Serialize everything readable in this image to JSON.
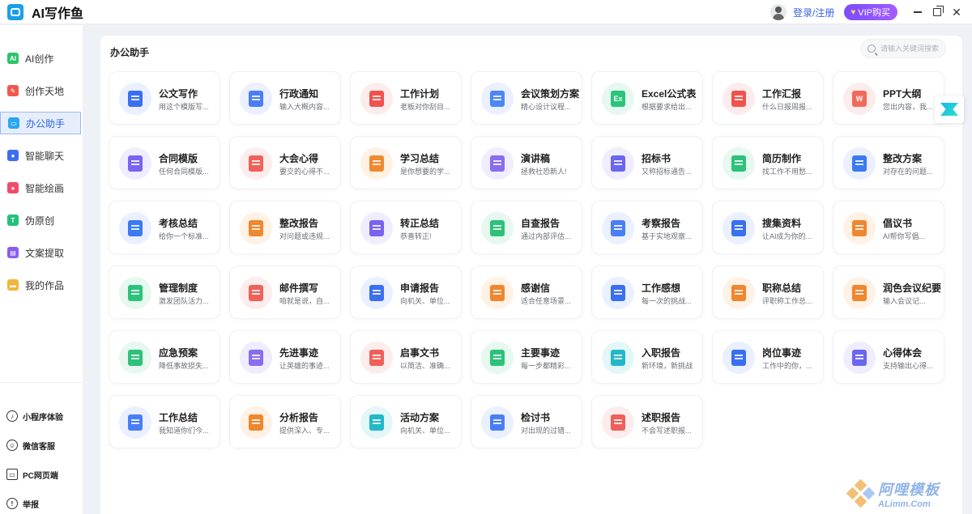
{
  "app": {
    "title": "AI写作鱼"
  },
  "header": {
    "login": "登录/注册",
    "vip": "VIP购买",
    "vip_icon": "heart-icon"
  },
  "sidebar": {
    "items": [
      {
        "label": "AI创作",
        "icon": "ai-create-icon",
        "color": "#2bc46b",
        "glyph": "AI",
        "active": false
      },
      {
        "label": "创作天地",
        "icon": "pen-icon",
        "color": "#f1564f",
        "glyph": "✎",
        "active": false
      },
      {
        "label": "办公助手",
        "icon": "briefcase-icon",
        "color": "#2aa7f0",
        "glyph": "▭",
        "active": true
      },
      {
        "label": "智能聊天",
        "icon": "chat-icon",
        "color": "#3d6ef0",
        "glyph": "●",
        "active": false
      },
      {
        "label": "智能绘画",
        "icon": "palette-icon",
        "color": "#f14a6b",
        "glyph": "●",
        "active": false
      },
      {
        "label": "伪原创",
        "icon": "rewrite-icon",
        "color": "#22c27a",
        "glyph": "T",
        "active": false
      },
      {
        "label": "文案提取",
        "icon": "extract-icon",
        "color": "#8a5cf0",
        "glyph": "▤",
        "active": false
      },
      {
        "label": "我的作品",
        "icon": "folder-icon",
        "color": "#f4b43a",
        "glyph": "▬",
        "active": false
      }
    ],
    "bottom": [
      {
        "label": "小程序体验",
        "icon": "miniprogram-icon"
      },
      {
        "label": "微信客服",
        "icon": "wechat-service-icon"
      },
      {
        "label": "PC网页端",
        "icon": "pc-web-icon"
      },
      {
        "label": "举报",
        "icon": "report-icon"
      }
    ]
  },
  "main": {
    "title": "办公助手",
    "search_placeholder": "请输入关键词搜索",
    "cards": [
      {
        "title": "公文写作",
        "desc": "用这个模版写...",
        "color": "#3b6ff2",
        "bg": "#eaf0ff"
      },
      {
        "title": "行政通知",
        "desc": "输入大概内容...",
        "color": "#4a7ef5",
        "bg": "#eaf0ff"
      },
      {
        "title": "工作计划",
        "desc": "老板对你刮目...",
        "color": "#f0524d",
        "bg": "#fdecec"
      },
      {
        "title": "会议策划方案",
        "desc": "精心设计议程...",
        "color": "#4d86f5",
        "bg": "#eaf0ff"
      },
      {
        "title": "Excel公式表",
        "desc": "根据要求给出...",
        "color": "#2bc47a",
        "bg": "#e6f8ef",
        "glyph": "Ex"
      },
      {
        "title": "工作汇报",
        "desc": "什么日报周报...",
        "color": "#f0524d",
        "bg": "#fdecec"
      },
      {
        "title": "PPT大纲",
        "desc": "您出内容，我...",
        "color": "#f06a5a",
        "bg": "#fdecec",
        "glyph": "W"
      },
      {
        "title": "合同模版",
        "desc": "任何合同模版...",
        "color": "#7a63f2",
        "bg": "#efedff"
      },
      {
        "title": "大会心得",
        "desc": "要交的心得不...",
        "color": "#f0605a",
        "bg": "#fdecec"
      },
      {
        "title": "学习总结",
        "desc": "是你想要的学...",
        "color": "#f08a2e",
        "bg": "#fff1e4"
      },
      {
        "title": "演讲稿",
        "desc": "拯救社恐新人!",
        "color": "#8a6cf0",
        "bg": "#efedff"
      },
      {
        "title": "招标书",
        "desc": "又称招标通告...",
        "color": "#6a66f0",
        "bg": "#efedff"
      },
      {
        "title": "简历制作",
        "desc": "找工作不用愁...",
        "color": "#2cc27a",
        "bg": "#e6f8ef"
      },
      {
        "title": "整改方案",
        "desc": "对存在的问题...",
        "color": "#3b7af2",
        "bg": "#eaf0ff"
      },
      {
        "title": "考核总结",
        "desc": "给你一个标准...",
        "color": "#3b7af2",
        "bg": "#eaf0ff"
      },
      {
        "title": "整改报告",
        "desc": "对问题或违规...",
        "color": "#f0862e",
        "bg": "#fff1e4"
      },
      {
        "title": "转正总结",
        "desc": "恭喜转正!",
        "color": "#7a63f2",
        "bg": "#efedff"
      },
      {
        "title": "自查报告",
        "desc": "通过内部评估...",
        "color": "#2cc27a",
        "bg": "#e6f8ef"
      },
      {
        "title": "考察报告",
        "desc": "基于实地观察...",
        "color": "#4a7ef5",
        "bg": "#eaf0ff"
      },
      {
        "title": "搜集资料",
        "desc": "让AI成为你的...",
        "color": "#3b6ff2",
        "bg": "#eaf0ff"
      },
      {
        "title": "倡议书",
        "desc": "AI帮你写倡...",
        "color": "#f0862e",
        "bg": "#fff1e4"
      },
      {
        "title": "管理制度",
        "desc": "激发团队活力...",
        "color": "#2cc27a",
        "bg": "#e6f8ef"
      },
      {
        "title": "邮件撰写",
        "desc": "咱就是说，自...",
        "color": "#f0605a",
        "bg": "#fdecec"
      },
      {
        "title": "申请报告",
        "desc": "向机关、单位...",
        "color": "#3b6ff2",
        "bg": "#eaf0ff"
      },
      {
        "title": "感谢信",
        "desc": "适合任意场景...",
        "color": "#f0862e",
        "bg": "#fff1e4"
      },
      {
        "title": "工作感想",
        "desc": "每一次的挑战...",
        "color": "#3b6ff2",
        "bg": "#eaf0ff"
      },
      {
        "title": "职称总结",
        "desc": "评职称工作总...",
        "color": "#f0862e",
        "bg": "#fff1e4"
      },
      {
        "title": "润色会议纪要",
        "desc": "输入会议记...",
        "color": "#f0862e",
        "bg": "#fff1e4"
      },
      {
        "title": "应急预案",
        "desc": "降低事故损失...",
        "color": "#2cc27a",
        "bg": "#e6f8ef"
      },
      {
        "title": "先进事迹",
        "desc": "让英雄的事迹...",
        "color": "#8a6cf0",
        "bg": "#efedff"
      },
      {
        "title": "启事文书",
        "desc": "以简洁、准确...",
        "color": "#f0605a",
        "bg": "#fdecec"
      },
      {
        "title": "主要事迹",
        "desc": "每一步都精彩...",
        "color": "#2cc27a",
        "bg": "#e6f8ef"
      },
      {
        "title": "入职报告",
        "desc": "新环境，新挑战",
        "color": "#22b8c8",
        "bg": "#e4f7f8"
      },
      {
        "title": "岗位事迹",
        "desc": "工作中的你，...",
        "color": "#3b6ff2",
        "bg": "#eaf0ff"
      },
      {
        "title": "心得体会",
        "desc": "支持输出心得...",
        "color": "#6a66f0",
        "bg": "#efedff"
      },
      {
        "title": "工作总结",
        "desc": "我知道你们今...",
        "color": "#4a7ef5",
        "bg": "#eaf0ff"
      },
      {
        "title": "分析报告",
        "desc": "提供深入、专...",
        "color": "#f0862e",
        "bg": "#fff1e4"
      },
      {
        "title": "活动方案",
        "desc": "向机关、单位...",
        "color": "#22b8c8",
        "bg": "#e4f7f8"
      },
      {
        "title": "检讨书",
        "desc": "对出现的过错...",
        "color": "#4a7ef5",
        "bg": "#eaf0ff"
      },
      {
        "title": "述职报告",
        "desc": "不会写述职报...",
        "color": "#f0605a",
        "bg": "#fdecec"
      }
    ]
  },
  "watermark": {
    "cn": "阿哩模板",
    "en": "ALimm.Com"
  }
}
